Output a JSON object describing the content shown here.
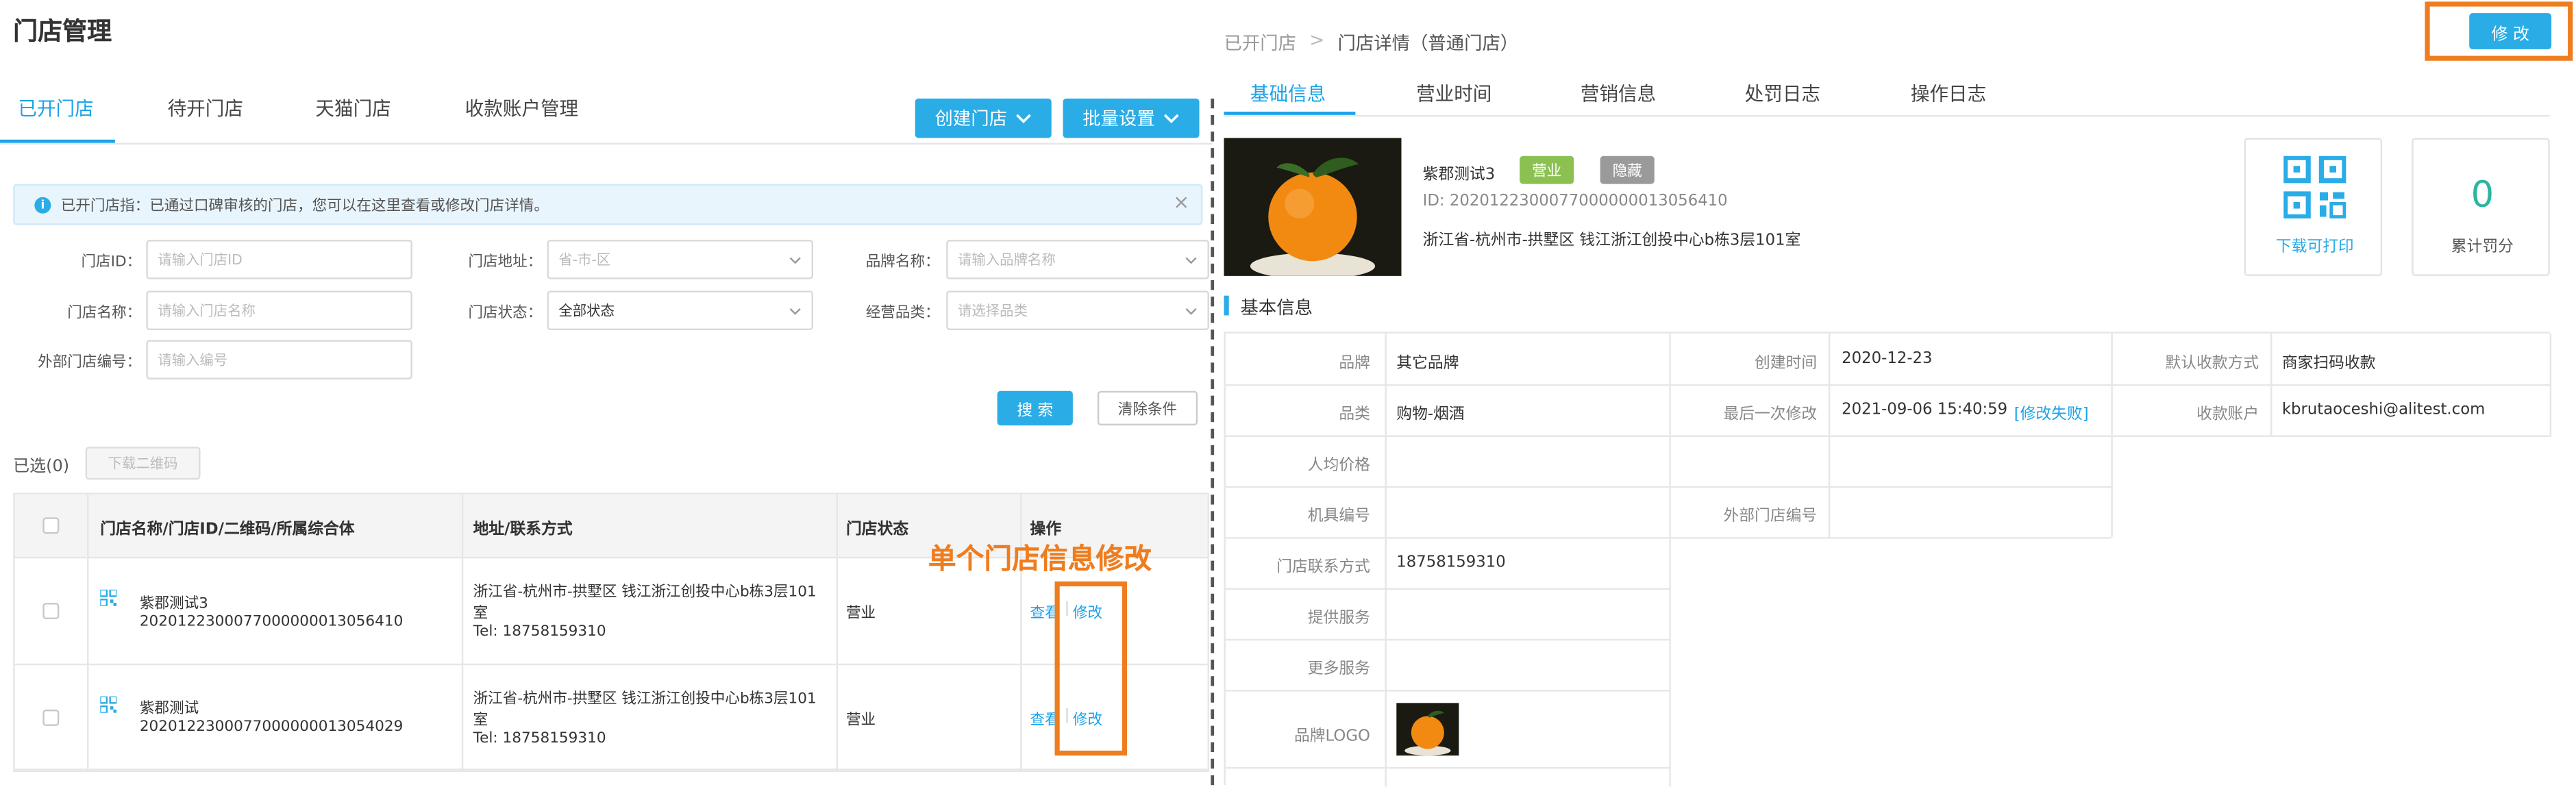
{
  "left": {
    "page_title": "门店管理",
    "tabs": [
      "已开门店",
      "待开门店",
      "天猫门店",
      "收款账户管理"
    ],
    "actions": {
      "create": "创建门店",
      "batch": "批量设置"
    },
    "notice": "已开门店指：已通过口碑审核的门店，您可以在这里查看或修改门店详情。",
    "filters": {
      "store_id": {
        "label": "门店ID：",
        "placeholder": "请输入门店ID"
      },
      "address": {
        "label": "门店地址：",
        "placeholder": "省-市-区"
      },
      "brand": {
        "label": "品牌名称：",
        "placeholder": "请输入品牌名称"
      },
      "store_name": {
        "label": "门店名称：",
        "placeholder": "请输入门店名称"
      },
      "status": {
        "label": "门店状态：",
        "value": "全部状态"
      },
      "category": {
        "label": "经营品类：",
        "placeholder": "请选择品类"
      },
      "external_id": {
        "label": "外部门店编号：",
        "placeholder": "请输入编号"
      }
    },
    "search_btn": "搜 索",
    "clear_btn": "清除条件",
    "selected": "已选(0)",
    "download_qr": "下载二维码",
    "table": {
      "headers": [
        "门店名称/门店ID/二维码/所属综合体",
        "地址/联系方式",
        "门店状态",
        "操作"
      ],
      "rows": [
        {
          "name": "紫郡测试3",
          "id": "2020122300077000000013056410",
          "addr1": "浙江省-杭州市-拱墅区 钱江浙江创投中心b栋3层101",
          "addr2": "室",
          "tel": "Tel:  18758159310",
          "status": "营业",
          "view": "查看",
          "sep": "|",
          "edit": "修改"
        },
        {
          "name": "紫郡测试",
          "id": "2020122300077000000013054029",
          "addr1": "浙江省-杭州市-拱墅区 钱江浙江创投中心b栋3层101",
          "addr2": "室",
          "tel": "Tel:  18758159310",
          "status": "营业",
          "view": "查看",
          "sep": "|",
          "edit": "修改"
        }
      ]
    },
    "annotation": "单个门店信息修改"
  },
  "right": {
    "breadcrumb": {
      "parent": "已开门店",
      "sep": ">",
      "current": "门店详情（普通门店）"
    },
    "edit_btn": "修 改",
    "tabs": [
      "基础信息",
      "营业时间",
      "营销信息",
      "处罚日志",
      "操作日志"
    ],
    "store": {
      "name": "紫郡测试3",
      "tag_open": "营业",
      "tag_hidden": "隐藏",
      "id": "ID: 2020122300077000000013056410",
      "address": "浙江省-杭州市-拱墅区 钱江浙江创投中心b栋3层101室"
    },
    "qr_label": "下载可打印",
    "penalty": {
      "value": "0",
      "label": "累计罚分"
    },
    "section_title": "基本信息",
    "info": {
      "brand": {
        "label": "品牌",
        "value": "其它品牌"
      },
      "created": {
        "label": "创建时间",
        "value": "2020-12-23"
      },
      "pay_method": {
        "label": "默认收款方式",
        "value": "商家扫码收款"
      },
      "category": {
        "label": "品类",
        "value": "购物-烟酒"
      },
      "last_modified": {
        "label": "最后一次修改",
        "value": "2021-09-06 15:40:59",
        "link": "[修改失败]"
      },
      "account": {
        "label": "收款账户",
        "value": "kbrutaoceshi@alitest.com"
      },
      "avg_price": {
        "label": "人均价格"
      },
      "device": {
        "label": "机具编号"
      },
      "external_id": {
        "label": "外部门店编号"
      },
      "phone": {
        "label": "门店联系方式",
        "value": "18758159310"
      },
      "services": {
        "label": "提供服务"
      },
      "more_services": {
        "label": "更多服务"
      },
      "logo": {
        "label": "品牌LOGO"
      }
    }
  },
  "colors": {
    "accent": "#2aace6",
    "annotation": "#ee7d1f",
    "tag_green": "#8cc152",
    "tag_gray": "#9a9a9a"
  }
}
